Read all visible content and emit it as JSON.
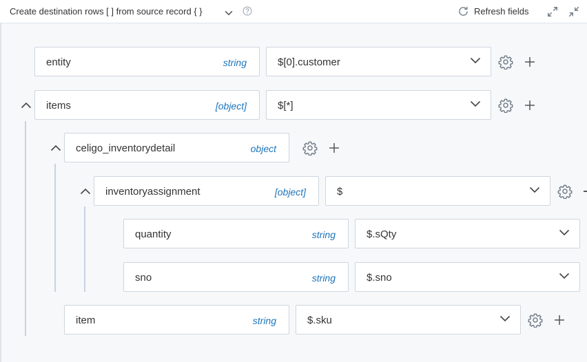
{
  "toolbar": {
    "title": "Create destination rows [ ] from source record { }",
    "refresh_label": "Refresh fields"
  },
  "rows": [
    {
      "name": "entity",
      "type": "string",
      "source": "$[0].customer"
    },
    {
      "name": "items",
      "type": "[object]",
      "source": "$[*]"
    },
    {
      "name": "celigo_inventorydetail",
      "type": "object"
    },
    {
      "name": "inventoryassignment",
      "type": "[object]",
      "source": "$"
    },
    {
      "name": "quantity",
      "type": "string",
      "source": "$.sQty"
    },
    {
      "name": "sno",
      "type": "string",
      "source": "$.sno"
    },
    {
      "name": "item",
      "type": "string",
      "source": "$.sku"
    }
  ],
  "colors": {
    "type_text": "#1b74bb",
    "icon": "#6b7682",
    "tree_line": "#c7d3de"
  }
}
